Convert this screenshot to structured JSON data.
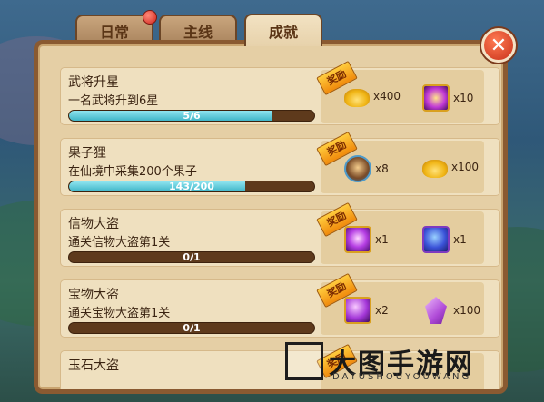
{
  "tabs": [
    {
      "label": "日常",
      "has_badge": true
    },
    {
      "label": "主线",
      "has_badge": false
    },
    {
      "label": "成就",
      "active": true
    }
  ],
  "reward_tag": "奖励",
  "achievements": [
    {
      "title": "武将升星",
      "desc": "一名武将升到6星",
      "progress_text": "5/6",
      "progress": 0.833,
      "rewards": [
        {
          "icon": "gold-ingot-icon",
          "count": "x400"
        },
        {
          "icon": "purple-gem-icon",
          "count": "x10"
        }
      ]
    },
    {
      "title": "果子狸",
      "desc": "在仙境中采集200个果子",
      "progress_text": "143/200",
      "progress": 0.715,
      "rewards": [
        {
          "icon": "hero-portrait-icon",
          "count": "x8"
        },
        {
          "icon": "gold-ingot-icon",
          "count": "x100"
        }
      ]
    },
    {
      "title": "信物大盗",
      "desc": "通关信物大盗第1关",
      "progress_text": "0/1",
      "progress": 0,
      "rewards": [
        {
          "icon": "purple-token-icon",
          "count": "x1"
        },
        {
          "icon": "blue-drop-icon",
          "count": "x1"
        }
      ]
    },
    {
      "title": "宝物大盗",
      "desc": "通关宝物大盗第1关",
      "progress_text": "0/1",
      "progress": 0,
      "rewards": [
        {
          "icon": "purple-orb-icon",
          "count": "x2"
        },
        {
          "icon": "purple-crystal-icon",
          "count": "x100"
        }
      ]
    },
    {
      "title": "玉石大盗"
    }
  ],
  "watermark": {
    "text": "大图手游网",
    "sub": "DATUSHOUYOUWANG"
  },
  "colors": {
    "panel": "#e5cfa5",
    "border": "#8a5a31",
    "progress": "#3fb6c8",
    "tag": "#f08a0c"
  }
}
